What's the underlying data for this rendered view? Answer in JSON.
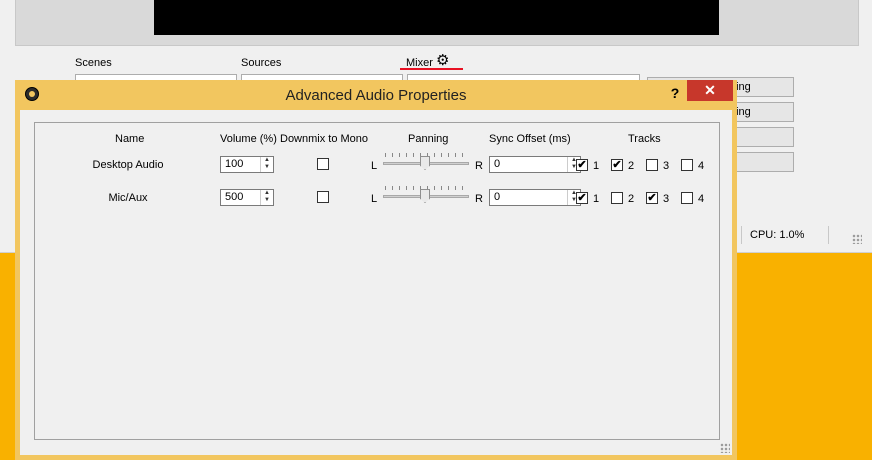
{
  "main_window": {
    "panels": {
      "scenes": "Scenes",
      "sources": "Sources",
      "mixer": "Mixer"
    },
    "side_buttons": [
      "ning",
      "ding",
      "",
      ""
    ],
    "status": {
      "cpu": "CPU: 1.0%"
    }
  },
  "dialog": {
    "title": "Advanced Audio Properties",
    "help": "?",
    "close": "✕",
    "headers": {
      "name": "Name",
      "volume": "Volume (%)",
      "downmix": "Downmix to Mono",
      "panning": "Panning",
      "sync": "Sync Offset (ms)",
      "tracks": "Tracks"
    },
    "pan_left": "L",
    "pan_right": "R",
    "rows": [
      {
        "name": "Desktop Audio",
        "volume": "100",
        "downmix": false,
        "panning": 0.5,
        "sync_offset": "0",
        "tracks": [
          true,
          true,
          false,
          false
        ]
      },
      {
        "name": "Mic/Aux",
        "volume": "500",
        "downmix": false,
        "panning": 0.5,
        "sync_offset": "0",
        "tracks": [
          true,
          false,
          true,
          false
        ]
      }
    ],
    "track_labels": [
      "1",
      "2",
      "3",
      "4"
    ]
  },
  "icons": {
    "gear": "gear-icon",
    "app": "obs-app-icon",
    "check": "✔"
  },
  "colors": {
    "desktop": "#f9b100",
    "titlebar": "#f2c65f",
    "close": "#c7372b",
    "mixer_underline": "#e81123"
  }
}
